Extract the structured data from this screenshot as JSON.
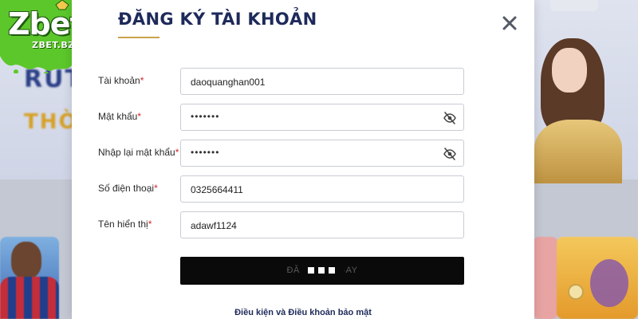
{
  "logo": {
    "text": "Zbet",
    "sub": "ZBET.BZ"
  },
  "background": {
    "banner_word_1": "RÚT",
    "banner_word_2": "THỜI"
  },
  "modal": {
    "title": "ĐĂNG KÝ TÀI KHOẢN",
    "close_icon": "close-icon",
    "fields": [
      {
        "label": "Tài khoản",
        "required": "*",
        "value": "daoquanghan001",
        "type": "text"
      },
      {
        "label": "Mật khẩu",
        "required": "*",
        "value": "•••••••",
        "type": "password",
        "toggle_icon": "eye-slash-icon"
      },
      {
        "label": "Nhập lại mật khẩu",
        "required": "*",
        "value": "•••••••",
        "type": "password",
        "toggle_icon": "eye-slash-icon"
      },
      {
        "label": "Số điện thoại",
        "required": "*",
        "value": "0325664411",
        "type": "text"
      },
      {
        "label": "Tên hiển thị",
        "required": "*",
        "value": "adawf1124",
        "type": "text"
      }
    ],
    "submit_label": "ĐĂNG KÝ NGAY",
    "terms_link": "Điều kiện và Điều khoản bảo mật"
  },
  "colors": {
    "title": "#1e2a5a",
    "required_mark": "#d8232a",
    "accent_underline": "#c9a24a",
    "submit_bg": "#0a0a0a",
    "logo_green": "#5cc72a"
  }
}
